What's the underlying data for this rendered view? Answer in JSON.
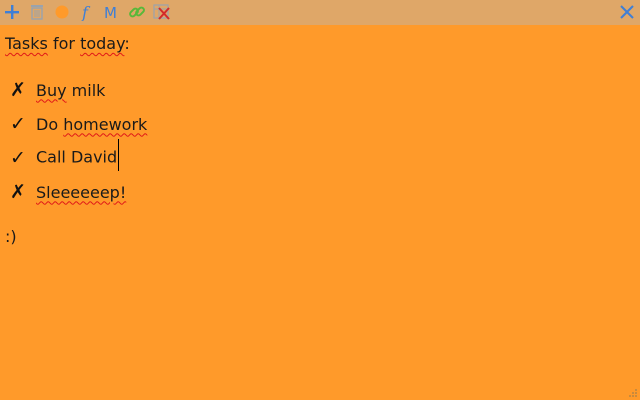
{
  "toolbar": {
    "buttons": [
      {
        "name": "add-note",
        "icon": "plus-icon",
        "color": "#3f7fd6"
      },
      {
        "name": "delete-note",
        "icon": "trash-icon",
        "color": "#9aa3ad"
      },
      {
        "name": "note-color",
        "icon": "color-dot-icon",
        "color": "#ff9a2a"
      },
      {
        "name": "font",
        "icon": "font-f-icon",
        "color": "#3f7fd6"
      },
      {
        "name": "markdown",
        "icon": "markdown-m-icon",
        "color": "#3f7fd6"
      },
      {
        "name": "link",
        "icon": "link-icon",
        "color": "#58b83a"
      },
      {
        "name": "clear-formatting",
        "icon": "clear-format-icon",
        "color": "#d42a2a"
      }
    ],
    "close_icon": "close-icon"
  },
  "note": {
    "title": "Tasks for today:",
    "tasks": [
      {
        "mark": "✗",
        "text_parts": [
          "Buy",
          " milk"
        ],
        "misspelled": [
          true,
          false
        ],
        "status": "not-done"
      },
      {
        "mark": "✓",
        "text_parts": [
          "Do ",
          "homework"
        ],
        "misspelled": [
          false,
          true
        ],
        "status": "done"
      },
      {
        "mark": "✓",
        "text_parts": [
          "Call David",
          ""
        ],
        "misspelled": [
          false,
          false
        ],
        "status": "done"
      },
      {
        "mark": "✗",
        "text_parts": [
          "Sleeeeeep!",
          ""
        ],
        "misspelled": [
          true,
          false
        ],
        "status": "not-done"
      }
    ],
    "footer": ":)"
  },
  "colors": {
    "note_background": "#ff9a2a",
    "toolbar_background": "#dfa768",
    "spellcheck": "#e01818"
  }
}
